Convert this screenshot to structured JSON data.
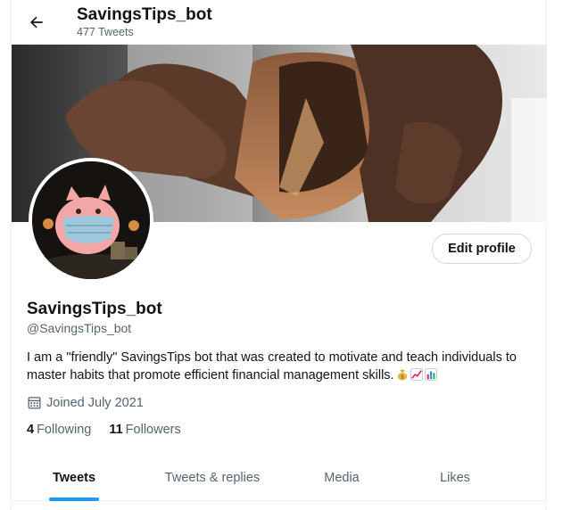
{
  "header": {
    "name": "SavingsTips_bot",
    "tweet_count": "477 Tweets"
  },
  "profile": {
    "name": "SavingsTips_bot",
    "handle": "@SavingsTips_bot",
    "bio": "I am a \"friendly\" SavingsTips bot that was created to motivate and teach individuals to master habits that promote efficient financial management skills.",
    "bio_emojis": [
      "money-bag-icon",
      "chart-increasing-icon",
      "bar-chart-icon"
    ],
    "joined": "Joined July 2021",
    "edit_label": "Edit profile",
    "following_count": "4",
    "following_label": "Following",
    "followers_count": "11",
    "followers_label": "Followers"
  },
  "tabs": [
    {
      "label": "Tweets",
      "active": true
    },
    {
      "label": "Tweets & replies",
      "active": false
    },
    {
      "label": "Media",
      "active": false
    },
    {
      "label": "Likes",
      "active": false
    }
  ],
  "colors": {
    "accent": "#1d9bf0",
    "text": "#0f1419",
    "muted": "#536471",
    "border": "#cfd9de"
  }
}
